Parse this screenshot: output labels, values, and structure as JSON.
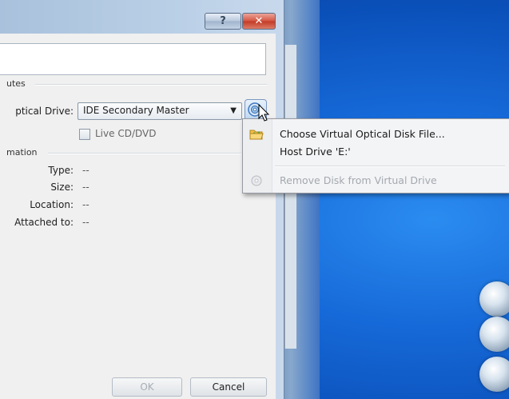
{
  "dialog": {
    "help_label": "?",
    "close_label": "✕",
    "attributes_group": "utes",
    "optical_drive_label": "ptical Drive:",
    "optical_drive_value": "IDE Secondary Master",
    "live_cd_label": "Live CD/DVD",
    "information_group": "mation",
    "info_rows": [
      {
        "label": "Type:",
        "value": "--"
      },
      {
        "label": "Size:",
        "value": "--"
      },
      {
        "label": "Location:",
        "value": "--"
      },
      {
        "label": "Attached to:",
        "value": "--"
      }
    ],
    "ok_label": "OK",
    "cancel_label": "Cancel"
  },
  "context_menu": {
    "items": [
      {
        "label": "Choose Virtual Optical Disk File...",
        "icon": "folder-open-icon",
        "enabled": true
      },
      {
        "label": "Host Drive 'E:'",
        "icon": "",
        "enabled": true
      },
      {
        "label": "Remove Disk from Virtual Drive",
        "icon": "eject-disc-icon",
        "enabled": false
      }
    ]
  },
  "colors": {
    "desktop_blue": "#1669d8",
    "window_frame": "#b9cfe6",
    "close_red": "#d4533f",
    "menu_background": "#f3f4f6"
  }
}
